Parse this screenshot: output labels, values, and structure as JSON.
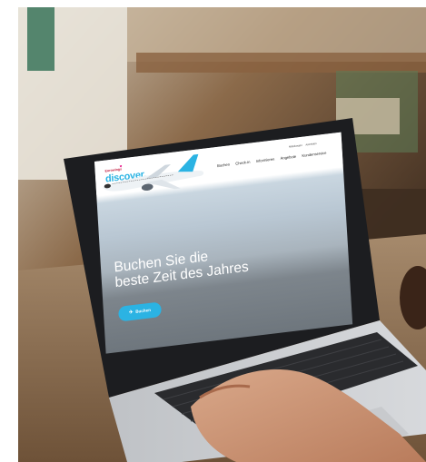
{
  "site": {
    "logo_small": "Eurowings",
    "logo_main": "discover.",
    "nav": [
      "Buchen",
      "Check-in",
      "Informieren",
      "Angebote",
      "Kundenservice"
    ],
    "top_links": [
      "Mitteilungen",
      "Anmelden"
    ],
    "hero": {
      "headline_line1": "Buchen Sie die",
      "headline_line2": "beste Zeit des Jahres",
      "cta_label": "Buchen"
    }
  },
  "colors": {
    "brand_blue": "#2bb3e3",
    "brand_magenta": "#e6007e"
  },
  "icons": {
    "cta": "airplane-icon",
    "logo": "heart-icon"
  }
}
